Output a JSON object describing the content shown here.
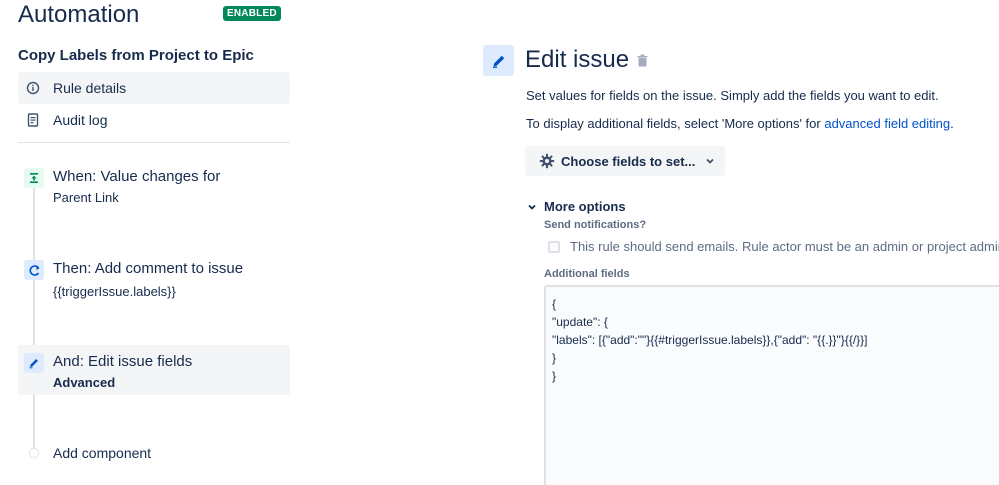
{
  "header": {
    "title": "Automation",
    "badge": "ENABLED"
  },
  "rule": {
    "name": "Copy Labels from Project to Epic"
  },
  "sidebar": {
    "items": [
      {
        "label": "Rule details",
        "icon": "info-icon",
        "active": true
      },
      {
        "label": "Audit log",
        "icon": "document-icon",
        "active": false
      }
    ]
  },
  "steps": [
    {
      "title": "When: Value changes for",
      "subtitle": "Parent Link",
      "icon": "trigger-icon"
    },
    {
      "title": "Then: Add comment to issue",
      "subtitle": "{{triggerIssue.labels}}",
      "icon": "action-icon"
    },
    {
      "title": "And: Edit issue fields",
      "subtitle": "Advanced",
      "icon": "pencil-icon"
    }
  ],
  "add_component": "Add component",
  "panel": {
    "title": "Edit issue",
    "desc1": "Set values for fields on the issue. Simply add the fields you want to edit.",
    "desc2_prefix": "To display additional fields, select 'More options' for ",
    "desc2_link": "advanced field editing",
    "desc2_suffix": ".",
    "choose_fields": "Choose fields to set...",
    "more_options": "More options",
    "send_notifications": "Send notifications?",
    "notif_checkbox": "This rule should send emails. Rule actor must be an admin or project admin",
    "additional_fields": "Additional fields",
    "json_lines": [
      "{",
      "\"update\": {",
      "\"labels\": [{\"add\":\"\"}{{#triggerIssue.labels}},{\"add\": \"{{.}}\"}{{/}}]",
      "}",
      "}"
    ]
  },
  "colors": {
    "badge": "#00875a",
    "link": "#0052cc",
    "icon_bg": "#deebff",
    "accent": "#0052cc"
  }
}
